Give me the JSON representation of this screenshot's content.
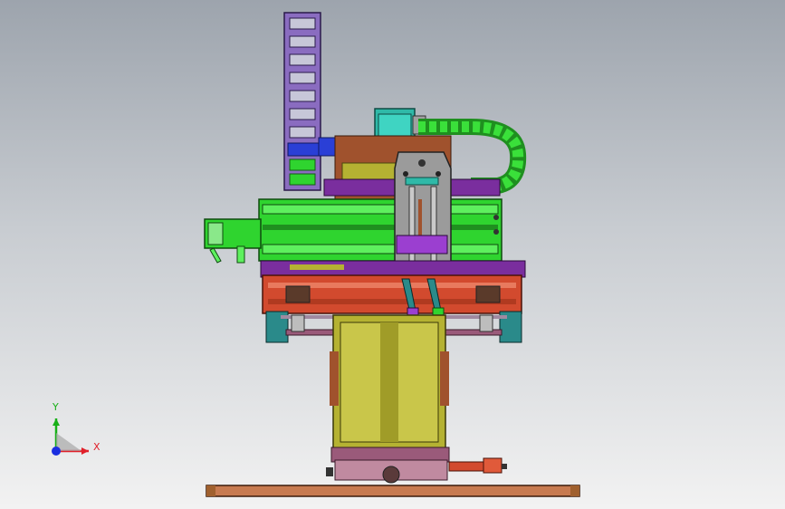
{
  "viewport": {
    "background_top": "#9da4ad",
    "background_bottom": "#f2f2f2"
  },
  "triad": {
    "x_label": "X",
    "y_label": "Y",
    "x_color": "#e0202a",
    "y_color": "#18b018",
    "z_color": "#1a2ee0"
  },
  "colors": {
    "green": "#2fd42f",
    "dark_green": "#1f8f1f",
    "purple": "#7a2e9e",
    "violet": "#9b3fd0",
    "red": "#d24a2e",
    "olive": "#b5b232",
    "teal": "#2fb9a8",
    "brown": "#a0522d",
    "copper": "#c07a4a",
    "gray": "#8a8a8a",
    "blue": "#2a3fd6",
    "base_plate": "#c77a50"
  }
}
